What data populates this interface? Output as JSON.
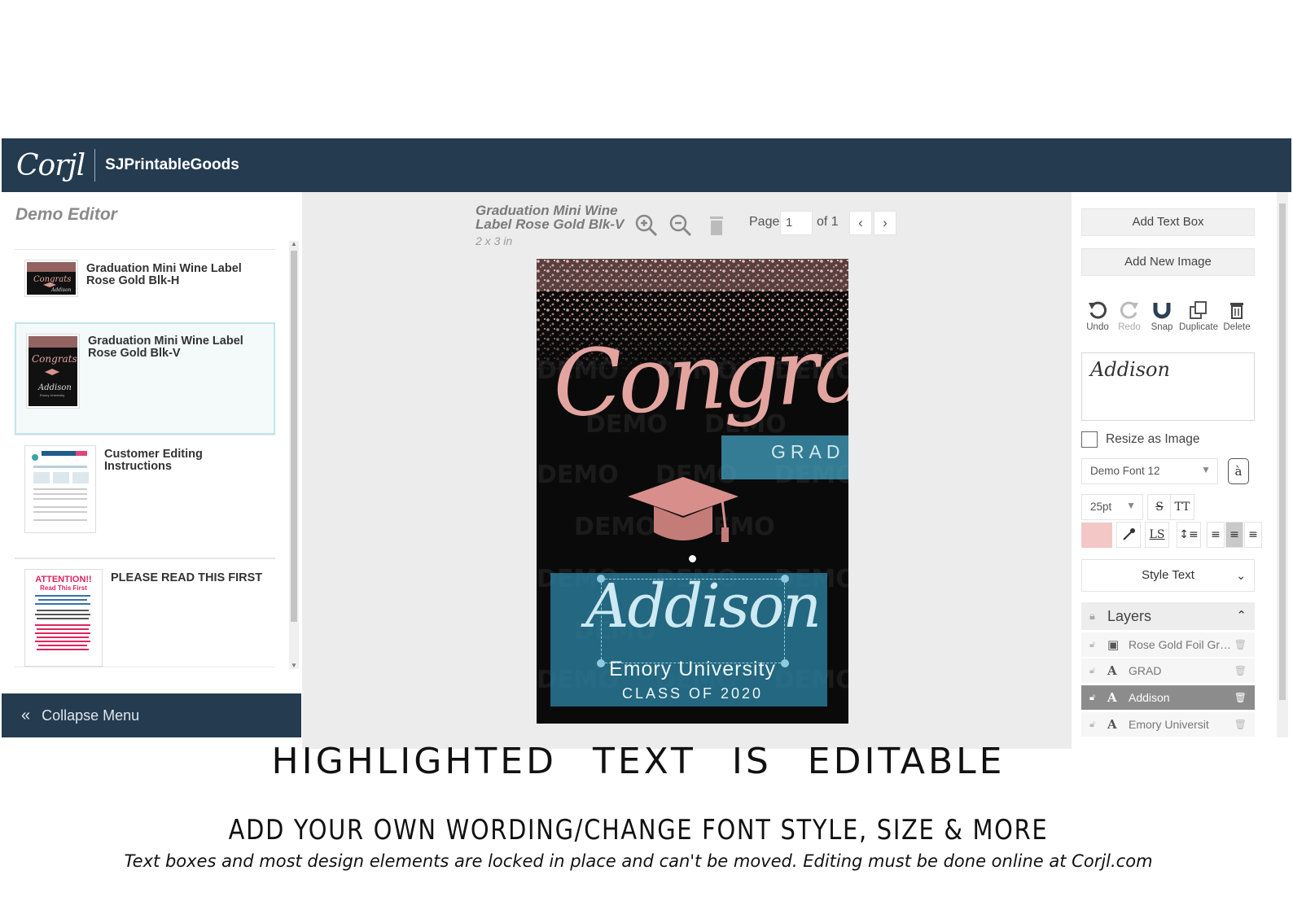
{
  "header": {
    "logo": "Corjl",
    "shop_name": "SJPrintableGoods"
  },
  "left_panel": {
    "title": "Demo Editor",
    "templates": [
      {
        "name": "Graduation Mini Wine Label Rose Gold Blk-H"
      },
      {
        "name": "Graduation Mini Wine Label Rose Gold Blk-V"
      },
      {
        "name": "Customer Editing Instructions"
      },
      {
        "name": "PLEASE READ THIS FIRST"
      }
    ],
    "thumb_attention": {
      "line1": "ATTENTION!!",
      "line2": "Read This First"
    },
    "collapse_label": "Collapse Menu"
  },
  "canvas": {
    "doc_title": "Graduation Mini Wine Label Rose Gold Blk-V",
    "doc_size": "2 x 3 in",
    "page_label": "Page",
    "page_value": "1",
    "page_of": "of 1",
    "label": {
      "watermark": "DEMO",
      "congrats": "Congrats",
      "grad": "GRAD",
      "name": "Addison",
      "university": "Emory University",
      "class": "CLASS OF 2020"
    }
  },
  "right_panel": {
    "add_text_box": "Add Text Box",
    "add_new_image": "Add New Image",
    "tools": [
      {
        "label": "Undo",
        "icon": "undo-icon"
      },
      {
        "label": "Redo",
        "icon": "redo-icon"
      },
      {
        "label": "Snap",
        "icon": "magnet-icon"
      },
      {
        "label": "Duplicate",
        "icon": "duplicate-icon"
      },
      {
        "label": "Delete",
        "icon": "trash-icon"
      }
    ],
    "text_value": "Addison",
    "resize_as_image": "Resize as Image",
    "font": "Demo Font 12",
    "size": "25pt",
    "color": "#f2c7c5",
    "style_text": "Style Text",
    "layers_title": "Layers",
    "layers": [
      {
        "name": "Rose Gold Foil Gra...",
        "type": "image"
      },
      {
        "name": "GRAD",
        "type": "text"
      },
      {
        "name": "Addison",
        "type": "text",
        "active": true
      },
      {
        "name": "Emory Universit",
        "type": "text"
      }
    ]
  },
  "captions": {
    "line1": "HIGHLIGHTED TEXT IS EDITABLE",
    "line2": "ADD YOUR OWN WORDING/CHANGE FONT STYLE, SIZE & MORE",
    "line3": "Text boxes and most design elements are locked in place and can't be moved. Editing must be done online at Corjl.com"
  },
  "colors": {
    "header": "#243b50",
    "accent_box": "#297d9b",
    "rose_gold": "#e3a4a0"
  }
}
